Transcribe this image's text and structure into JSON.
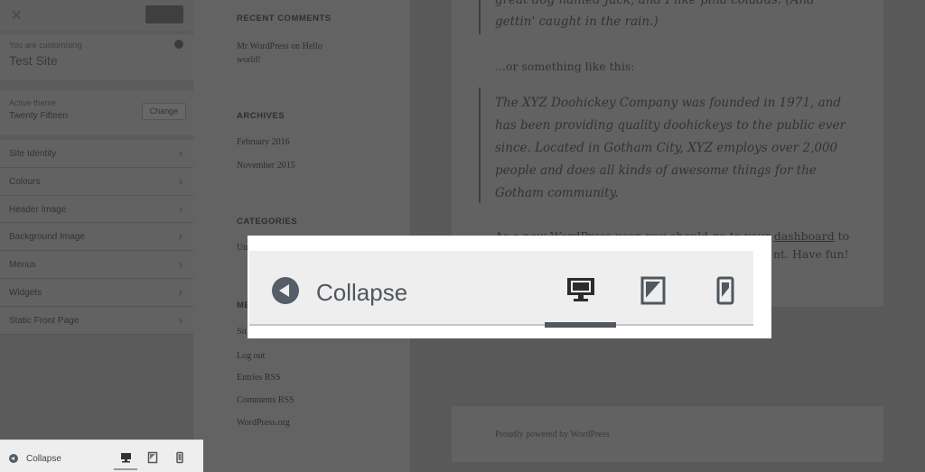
{
  "sidebar": {
    "close_icon": "close-icon",
    "customising_label": "You are customising",
    "site_name": "Test Site",
    "active_theme_label": "Active theme",
    "theme_name": "Twenty Fifteen",
    "change_label": "Change",
    "sections": [
      {
        "label": "Site Identity"
      },
      {
        "label": "Colours"
      },
      {
        "label": "Header Image"
      },
      {
        "label": "Background Image"
      },
      {
        "label": "Menus"
      },
      {
        "label": "Widgets"
      },
      {
        "label": "Static Front Page"
      }
    ]
  },
  "preview": {
    "recent_comments_title": "RECENT COMMENTS",
    "recent_comment": "Mr WordPress on Hello world!",
    "archives_title": "ARCHIVES",
    "archives": [
      "February 2016",
      "November 2015"
    ],
    "categories_title": "CATEGORIES",
    "categories_partial": "Un",
    "meta_partial_title": "ME",
    "meta_partial_item": "Sit",
    "meta_links": [
      "Log out",
      "Entries RSS",
      "Comments RSS",
      "WordPress.org"
    ],
    "quote1_line1": "great dog named Jack, and I like piña coladas. (And",
    "quote1_line2": "gettin' caught in the rain.)",
    "or_text": "...or something like this:",
    "quote2": [
      "The XYZ Doohickey Company was founded in 1971, and",
      "has been providing quality doohickeys to the public ever",
      "since. Located in Gotham City, XYZ employs over 2,000",
      "people and does all kinds of awesome things for the",
      "Gotham community."
    ],
    "para_line1_start": "As a new WordPress user, you should go to your",
    "para_link": "dashboard",
    "para_line1_end": "to",
    "para_line2_end": "nt. Have fun!",
    "powered_by": "Proudly powered by WordPress"
  },
  "footer_bar": {
    "collapse_label": "Collapse",
    "devices": [
      "desktop",
      "tablet",
      "mobile"
    ],
    "active_device": "desktop"
  },
  "zoom": {
    "collapse_label": "Collapse"
  }
}
